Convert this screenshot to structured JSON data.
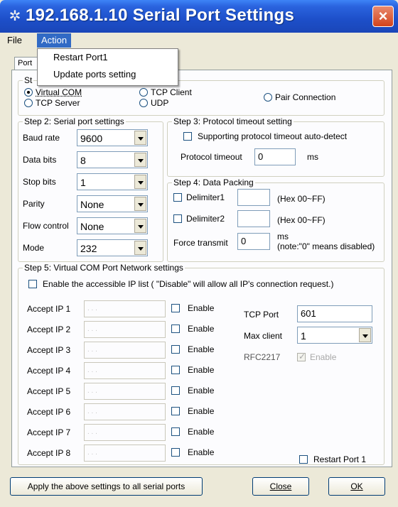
{
  "window": {
    "title": "192.168.1.10 Serial Port Settings",
    "icon": "gear-icon",
    "close": "×"
  },
  "menu": {
    "file": "File",
    "action": "Action"
  },
  "action_menu": {
    "items": [
      "Restart Port1",
      "Update ports setting"
    ]
  },
  "tab": {
    "label": "Port"
  },
  "step1": {
    "legend": "St",
    "options": [
      "Virtual COM",
      "TCP Server",
      "TCP Client",
      "UDP",
      "Pair Connection"
    ],
    "selected": "Virtual COM"
  },
  "step2": {
    "legend": "Step 2: Serial port settings",
    "rows": [
      {
        "label": "Baud rate",
        "value": "9600"
      },
      {
        "label": "Data bits",
        "value": "8"
      },
      {
        "label": "Stop bits",
        "value": "1"
      },
      {
        "label": "Parity",
        "value": "None"
      },
      {
        "label": "Flow control",
        "value": "None"
      },
      {
        "label": "Mode",
        "value": "232"
      }
    ]
  },
  "step3": {
    "legend": "Step 3: Protocol timeout setting",
    "autodetect_label": "Supporting protocol timeout auto-detect",
    "timeout_label": "Protocol timeout",
    "timeout_value": "0",
    "unit": "ms"
  },
  "step4": {
    "legend": "Step 4: Data Packing",
    "delimiter1_label": "Delimiter1",
    "delimiter1_value": "",
    "delimiter1_hint": "(Hex 00~FF)",
    "delimiter2_label": "Delimiter2",
    "delimiter2_value": "",
    "delimiter2_hint": "(Hex 00~FF)",
    "force_label": "Force transmit",
    "force_value": "0",
    "force_unit": "ms",
    "force_note": "(note:\"0\" means disabled)"
  },
  "step5": {
    "legend": "Step 5: Virtual COM Port Network settings",
    "enable_list_label": "Enable the accessible IP list ( \"Disable\" will allow all IP's connection request.)",
    "accept_ips": [
      {
        "label": "Accept IP 1",
        "value": ". . .",
        "enable": "Enable"
      },
      {
        "label": "Accept IP 2",
        "value": ". . .",
        "enable": "Enable"
      },
      {
        "label": "Accept IP 3",
        "value": ". . .",
        "enable": "Enable"
      },
      {
        "label": "Accept IP 4",
        "value": ". . .",
        "enable": "Enable"
      },
      {
        "label": "Accept IP 5",
        "value": ". . .",
        "enable": "Enable"
      },
      {
        "label": "Accept IP 6",
        "value": ". . .",
        "enable": "Enable"
      },
      {
        "label": "Accept IP 7",
        "value": ". . .",
        "enable": "Enable"
      },
      {
        "label": "Accept IP 8",
        "value": ". . .",
        "enable": "Enable"
      }
    ],
    "tcp_port_label": "TCP Port",
    "tcp_port_value": "601",
    "max_client_label": "Max client",
    "max_client_value": "1",
    "rfc_label": "RFC2217",
    "rfc_enable_label": "Enable",
    "restart_label": "Restart Port 1"
  },
  "buttons": {
    "apply_all": "Apply the above settings to all serial ports",
    "close": "Close",
    "ok": "OK"
  }
}
